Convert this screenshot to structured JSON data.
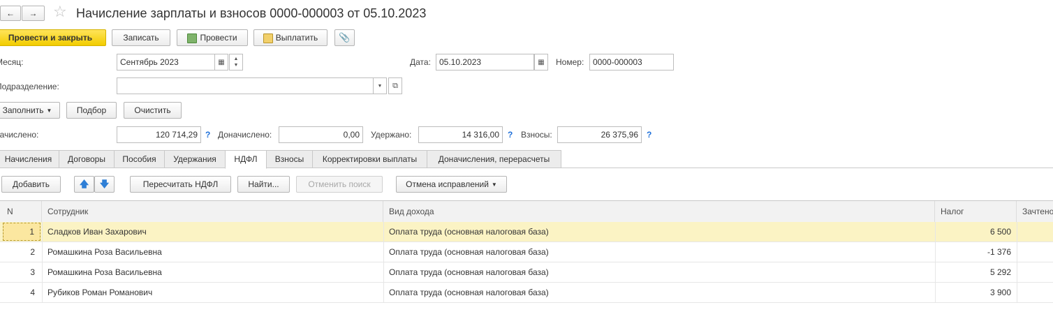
{
  "header": {
    "title": "Начисление зарплаты и взносов 0000-000003 от 05.10.2023"
  },
  "toolbar": {
    "post_close": "Провести и закрыть",
    "save": "Записать",
    "post": "Провести",
    "pay": "Выплатить"
  },
  "form": {
    "month_label": "Месяц:",
    "month_value": "Сентябрь 2023",
    "date_label": "Дата:",
    "date_value": "05.10.2023",
    "number_label": "Номер:",
    "number_value": "0000-000003",
    "department_label": "Подразделение:",
    "department_value": "",
    "fill_button": "Заполнить",
    "select_button": "Подбор",
    "clear_button": "Очистить",
    "accrued_label": "Начислено:",
    "accrued_value": "120 714,29",
    "additional_label": "Доначислено:",
    "additional_value": "0,00",
    "withheld_label": "Удержано:",
    "withheld_value": "14 316,00",
    "contrib_label": "Взносы:",
    "contrib_value": "26 375,96",
    "help_mark": "?"
  },
  "tabs": [
    {
      "label": "Начисления"
    },
    {
      "label": "Договоры"
    },
    {
      "label": "Пособия"
    },
    {
      "label": "Удержания"
    },
    {
      "label": "НДФЛ"
    },
    {
      "label": "Взносы"
    },
    {
      "label": "Корректировки выплаты"
    },
    {
      "label": "Доначисления, перерасчеты"
    }
  ],
  "active_tab": "НДФЛ",
  "table_toolbar": {
    "add": "Добавить",
    "recalc": "Пересчитать НДФЛ",
    "find": "Найти...",
    "cancel_search": "Отменить поиск",
    "cancel_corrections": "Отмена исправлений"
  },
  "table": {
    "columns": [
      "N",
      "Сотрудник",
      "Вид дохода",
      "Налог",
      "Зачтено"
    ],
    "rows": [
      {
        "n": "1",
        "employee": "Сладков Иван Захарович",
        "income": "Оплата труда (основная налоговая база)",
        "tax": "6 500"
      },
      {
        "n": "2",
        "employee": "Ромашкина Роза Васильевна",
        "income": "Оплата труда (основная налоговая база)",
        "tax": "-1 376"
      },
      {
        "n": "3",
        "employee": "Ромашкина Роза Васильевна",
        "income": "Оплата труда (основная налоговая база)",
        "tax": "5 292"
      },
      {
        "n": "4",
        "employee": "Рубиков Роман Романович",
        "income": "Оплата труда (основная налоговая база)",
        "tax": "3 900"
      }
    ]
  },
  "colors": {
    "primary_button": "#f7d418",
    "selected_row": "#fbf3c4",
    "help": "#1e6fd9"
  }
}
